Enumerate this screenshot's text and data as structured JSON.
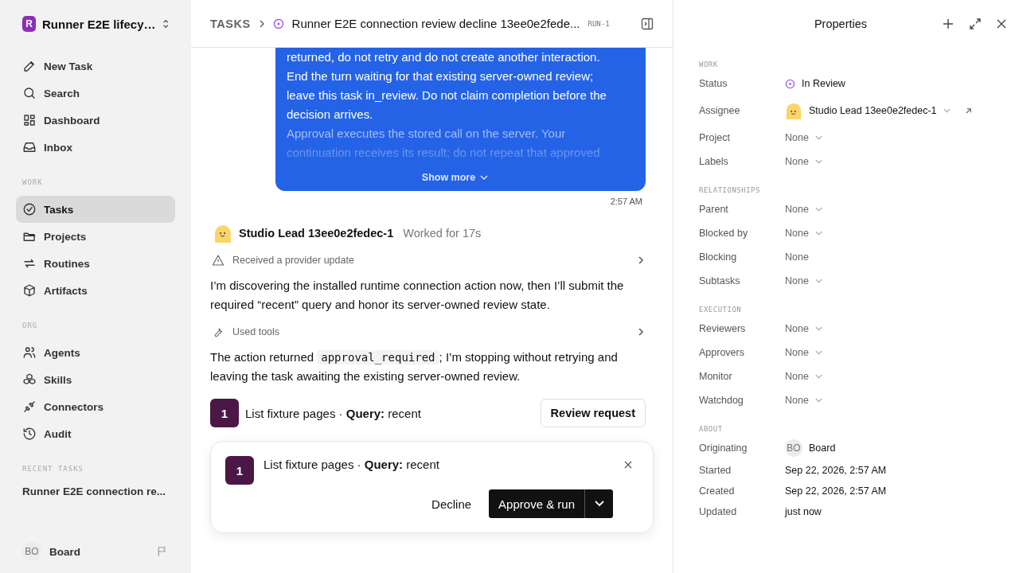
{
  "workspace": {
    "badge": "R",
    "name": "Runner E2E lifecy…"
  },
  "sidebar": {
    "top_items": [
      {
        "label": "New Task",
        "selected": false
      },
      {
        "label": "Search",
        "selected": false
      },
      {
        "label": "Dashboard",
        "selected": false
      },
      {
        "label": "Inbox",
        "selected": false
      }
    ],
    "sections": [
      {
        "title": "WORK",
        "items": [
          {
            "label": "Tasks",
            "selected": true
          },
          {
            "label": "Projects",
            "selected": false
          },
          {
            "label": "Routines",
            "selected": false
          },
          {
            "label": "Artifacts",
            "selected": false
          }
        ]
      },
      {
        "title": "ORG",
        "items": [
          {
            "label": "Agents",
            "selected": false
          },
          {
            "label": "Skills",
            "selected": false
          },
          {
            "label": "Connectors",
            "selected": false
          },
          {
            "label": "Audit",
            "selected": false
          }
        ]
      }
    ],
    "recent_title": "RECENT TASKS",
    "recent_tasks": [
      "Runner E2E connection re..."
    ],
    "user": {
      "initials": "BO",
      "name": "Board"
    }
  },
  "header": {
    "crumb": "TASKS",
    "title": "Runner E2E connection review decline 13ee0e2fede...",
    "run_id": "RUN-1"
  },
  "message": {
    "paragraphs": [
      {
        "text": "returned, do not retry and do not create another interaction. End the turn waiting for that existing server-owned review; leave this task in_review. Do not claim completion before the decision arrives.",
        "faded": false
      },
      {
        "text": "Approval executes the stored call on the server. Your continuation receives its result; do not repeat that approved",
        "faded": true
      }
    ],
    "show_more": "Show more",
    "time": "2:57 AM"
  },
  "agent": {
    "name": "Studio Lead 13ee0e2fedec-1",
    "worked": "Worked for 17s"
  },
  "activity": [
    {
      "kind": "event",
      "label": "Received a provider update"
    },
    {
      "kind": "text",
      "text": "I’m discovering the installed runtime connection action now, then I’ll submit the required “recent” query and honor its server-owned review state."
    },
    {
      "kind": "tools",
      "label": "Used tools"
    },
    {
      "kind": "code_text",
      "before": "The action returned ",
      "code": "approval_required",
      "after": "; I’m stopping without retrying and leaving the task awaiting the existing server-owned review."
    }
  ],
  "request": {
    "number": "1",
    "summary": "List fixture pages · **Query:** recent",
    "button": "Review request"
  },
  "approval": {
    "number": "1",
    "summary": "List fixture pages · **Query:** recent",
    "decline": "Decline",
    "approve": "Approve & run"
  },
  "properties": {
    "title": "Properties",
    "sections": [
      {
        "title": "WORK",
        "rows": [
          {
            "label": "Status",
            "kind": "status",
            "value": "In Review"
          },
          {
            "label": "Assignee",
            "kind": "person",
            "value": "Studio Lead 13ee0e2fedec-1"
          },
          {
            "label": "Project",
            "kind": "select",
            "value": "None"
          },
          {
            "label": "Labels",
            "kind": "select",
            "value": "None"
          }
        ]
      },
      {
        "title": "RELATIONSHIPS",
        "rows": [
          {
            "label": "Parent",
            "kind": "select",
            "value": "None"
          },
          {
            "label": "Blocked by",
            "kind": "select",
            "value": "None"
          },
          {
            "label": "Blocking",
            "kind": "plain",
            "value": "None"
          },
          {
            "label": "Subtasks",
            "kind": "select",
            "value": "None"
          }
        ]
      },
      {
        "title": "EXECUTION",
        "rows": [
          {
            "label": "Reviewers",
            "kind": "select",
            "value": "None"
          },
          {
            "label": "Approvers",
            "kind": "select",
            "value": "None"
          },
          {
            "label": "Monitor",
            "kind": "select",
            "value": "None"
          },
          {
            "label": "Watchdog",
            "kind": "select",
            "value": "None"
          }
        ]
      },
      {
        "title": "ABOUT",
        "rows": [
          {
            "label": "Originating",
            "kind": "initials",
            "initials": "BO",
            "value": "Board"
          },
          {
            "label": "Started",
            "kind": "date",
            "value": "Sep 22, 2026, 2:57 AM"
          },
          {
            "label": "Created",
            "kind": "date",
            "value": "Sep 22, 2026, 2:57 AM"
          },
          {
            "label": "Updated",
            "kind": "date",
            "value": "just now"
          }
        ]
      }
    ]
  }
}
